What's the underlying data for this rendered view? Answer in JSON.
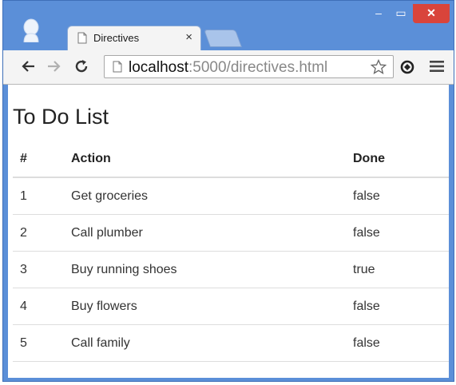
{
  "browser": {
    "tab": {
      "title": "Directives",
      "close": "×"
    },
    "window_controls": {
      "minimize": "–",
      "maximize": "▭",
      "close": "✕"
    },
    "address": {
      "host": "localhost",
      "path": ":5000/directives.html"
    },
    "icons": [
      "profile-icon",
      "page-icon",
      "close-icon",
      "back-icon",
      "forward-icon",
      "reload-icon",
      "star-icon",
      "extension-icon",
      "menu-icon"
    ]
  },
  "page": {
    "title": "To Do List",
    "table": {
      "headers": [
        "#",
        "Action",
        "Done"
      ],
      "rows": [
        [
          "1",
          "Get groceries",
          "false"
        ],
        [
          "2",
          "Call plumber",
          "false"
        ],
        [
          "3",
          "Buy running shoes",
          "true"
        ],
        [
          "4",
          "Buy flowers",
          "false"
        ],
        [
          "5",
          "Call family",
          "false"
        ]
      ]
    }
  },
  "colors": {
    "frame": "#5b8fd8",
    "close_button": "#d9443b",
    "table_border": "#dddddd"
  }
}
